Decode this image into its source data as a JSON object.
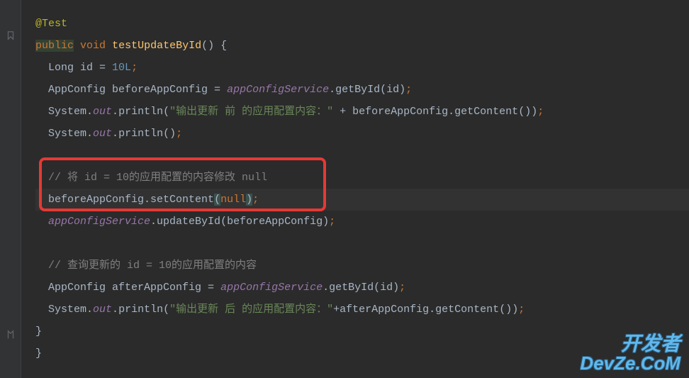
{
  "code": {
    "annotation": "@Test",
    "modifier_public": "public",
    "modifier_void": "void",
    "method_name": "testUpdateById",
    "parens_open": "()",
    "brace_open": " {",
    "long_type": "Long ",
    "id_var": "id",
    "eq": " = ",
    "ten_l": "10L",
    "semi": ";",
    "appconfig_type": "AppConfig ",
    "before_var": "beforeAppConfig",
    "service_field": "appConfigService",
    "dot": ".",
    "getbyid": "getById",
    "open_p": "(",
    "close_p": ")",
    "system": "System",
    "out": "out",
    "println": "println",
    "str_before": "\"输出更新 前 的应用配置内容：\"",
    "plus": " + ",
    "getcontent": "getContent",
    "empty_parens": "()",
    "comment_set": "// 将 id = 10的应用配置的内容修改 null",
    "setcontent": "setContent",
    "null_kw": "null",
    "updatebyid": "updateById",
    "comment_query": "// 查询更新的 id = 10的应用配置的内容",
    "after_var": "afterAppConfig",
    "str_after": "\"输出更新 后 的应用配置内容：\"",
    "plus2": "+",
    "brace_close": "}"
  },
  "watermark": {
    "cn": "开发者",
    "en": "DevZe.CoM"
  }
}
